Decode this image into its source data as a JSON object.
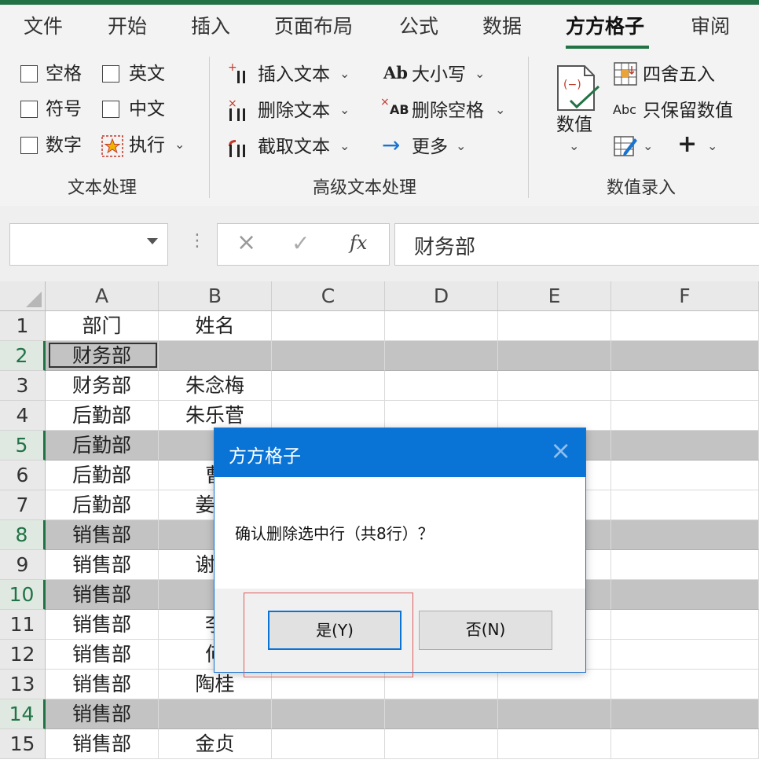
{
  "ribbon": {
    "tabs": [
      "文件",
      "开始",
      "插入",
      "页面布局",
      "公式",
      "数据",
      "方方格子",
      "审阅"
    ],
    "active_tab": "方方格子",
    "text_group": {
      "checkboxes": [
        "空格",
        "英文",
        "符号",
        "中文",
        "数字"
      ],
      "execute_label": "执行",
      "group_label": "文本处理"
    },
    "advanced_group": {
      "insert_text": "插入文本",
      "delete_text": "删除文本",
      "extract_text": "截取文本",
      "case_label": "大小写",
      "case_icon_text": "Ab",
      "remove_spaces": "删除空格",
      "remove_spaces_icon_text": "AB",
      "more": "更多",
      "group_label": "高级文本处理"
    },
    "number_group": {
      "value_label": "数值",
      "round_label": "四舍五入",
      "keep_numbers": "只保留数值",
      "keep_numbers_icon_text": "Abc",
      "value_icon_text": "(−)",
      "group_label": "数值录入"
    },
    "caret": "⌄"
  },
  "formula_bar": {
    "cancel_icon": "×",
    "confirm_icon": "✓",
    "fx_icon": "fx",
    "value": "财务部"
  },
  "grid": {
    "columns": [
      "A",
      "B",
      "C",
      "D",
      "E",
      "F"
    ],
    "row_numbers": [
      "1",
      "2",
      "3",
      "4",
      "5",
      "6",
      "7",
      "8",
      "9",
      "10",
      "11",
      "12",
      "13",
      "14",
      "15"
    ],
    "selected_rows": [
      2,
      5,
      8,
      10,
      14
    ],
    "colA": [
      "部门",
      "财务部",
      "财务部",
      "后勤部",
      "后勤部",
      "后勤部",
      "后勤部",
      "销售部",
      "销售部",
      "销售部",
      "销售部",
      "销售部",
      "销售部",
      "销售部",
      "销售部"
    ],
    "colB": [
      "姓名",
      "",
      "朱念梅",
      "朱乐菅",
      "",
      "曹",
      "姜忄",
      "",
      "谢丽",
      "",
      "李",
      "何",
      "陶桂",
      "",
      "金贞"
    ]
  },
  "dialog": {
    "title": "方方格子",
    "close": "×",
    "message": "确认删除选中行（共8行）？",
    "yes": "是(Y)",
    "no": "否(N)"
  },
  "colors": {
    "accent": "#217346",
    "dialog_title": "#0a74d6",
    "highlight_row": "#c3c3c3",
    "annotation_red": "#e05a5a"
  }
}
